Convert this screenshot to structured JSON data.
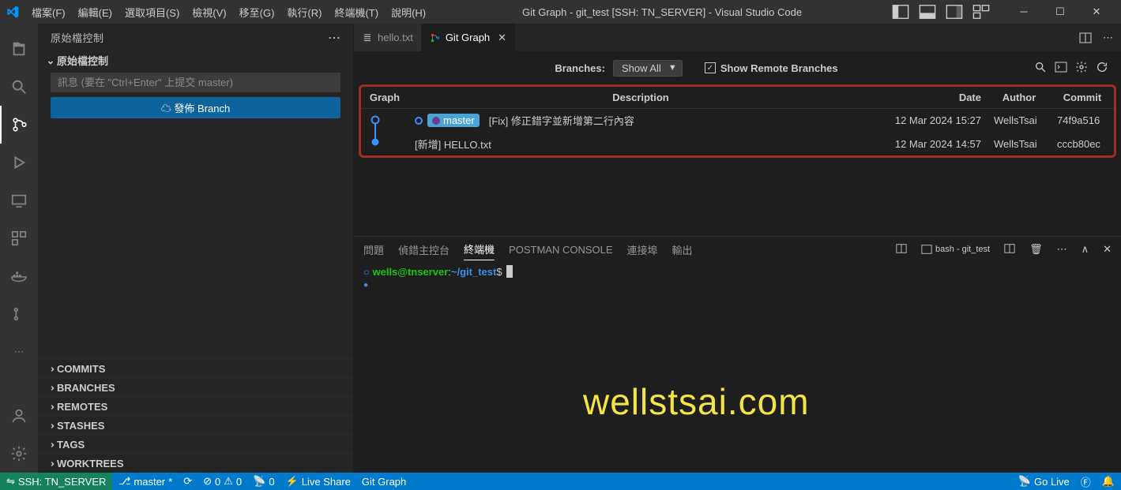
{
  "titlebar": {
    "menu": [
      "檔案(F)",
      "編輯(E)",
      "選取項目(S)",
      "檢視(V)",
      "移至(G)",
      "執行(R)",
      "終端機(T)",
      "說明(H)"
    ],
    "title": "Git Graph - git_test [SSH: TN_SERVER] - Visual Studio Code"
  },
  "sidebar": {
    "header": "原始檔控制",
    "section": "原始檔控制",
    "msg_placeholder": "訊息 (要在 \"Ctrl+Enter\" 上提交 master)",
    "publish_label": "發佈 Branch",
    "bottom_sections": [
      "COMMITS",
      "BRANCHES",
      "REMOTES",
      "STASHES",
      "TAGS",
      "WORKTREES"
    ]
  },
  "tabs": {
    "file_tab": "hello.txt",
    "gitgraph_tab": "Git Graph"
  },
  "gitgraph": {
    "branches_label": "Branches:",
    "branches_value": "Show All",
    "remote_check_label": "Show Remote Branches",
    "columns": {
      "graph": "Graph",
      "description": "Description",
      "date": "Date",
      "author": "Author",
      "commit": "Commit"
    },
    "rows": [
      {
        "branch_tag": "master",
        "desc": "[Fix] 修正錯字並新增第二行內容",
        "date": "12 Mar 2024 15:27",
        "author": "WellsTsai",
        "commit": "74f9a516",
        "head": true
      },
      {
        "desc": "[新增] HELLO.txt",
        "date": "12 Mar 2024 14:57",
        "author": "WellsTsai",
        "commit": "cccb80ec",
        "head": false
      }
    ]
  },
  "panel": {
    "tabs": [
      "問題",
      "偵錯主控台",
      "終端機",
      "POSTMAN CONSOLE",
      "連接埠",
      "輸出"
    ],
    "shell_label": "bash - git_test",
    "prompt_user": "wells@tnserver",
    "prompt_sep": ":",
    "prompt_path": "~/git_test",
    "prompt_end": "$",
    "watermark": "wellstsai.com"
  },
  "statusbar": {
    "remote": "SSH: TN_SERVER",
    "branch": "master",
    "sync": "",
    "errors": "0",
    "warnings": "0",
    "ports": "0",
    "liveshare": "Live Share",
    "gitgraph": "Git Graph",
    "golive": "Go Live"
  }
}
